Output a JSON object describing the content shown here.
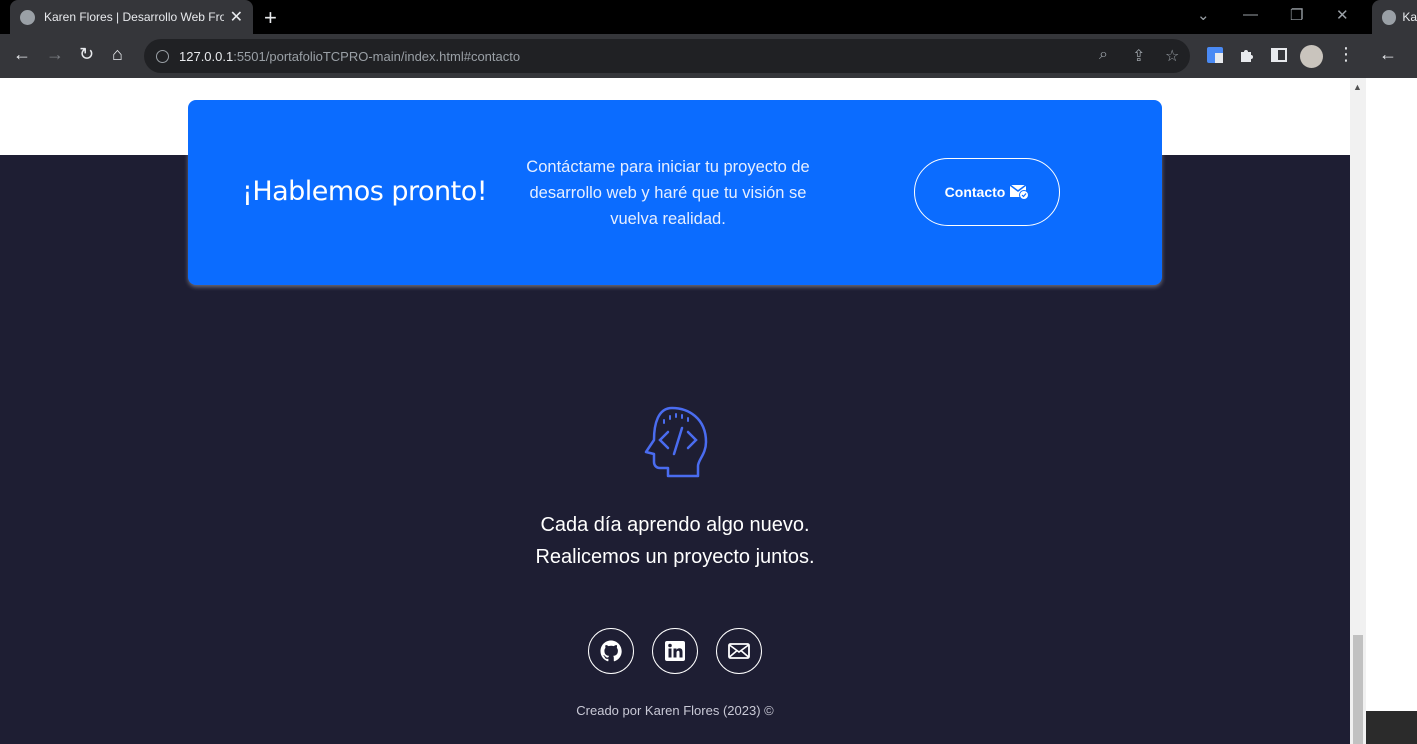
{
  "browser": {
    "tab_title": "Karen Flores | Desarrollo Web Fro",
    "second_tab_title": "Ka",
    "url_host": "127.0.0.1",
    "url_rest": ":5501/portafolioTCPRO-main/index.html#contacto"
  },
  "cta": {
    "title": "¡Hablemos pronto!",
    "text": "Contáctame para iniciar tu proyecto de desarrollo web y haré que tu visión se vuelva realidad.",
    "button_label": "Contacto"
  },
  "tagline": {
    "line1": "Cada día aprendo algo nuevo.",
    "line2": "Realicemos un proyecto juntos."
  },
  "social": [
    "github-icon",
    "linkedin-icon",
    "email-icon"
  ],
  "footer": {
    "text": "Creado por Karen Flores (2023) ©"
  },
  "colors": {
    "page_bg": "#1e1e33",
    "cta_bg": "#0b6cff",
    "accent_icon": "#4a6cf0"
  }
}
